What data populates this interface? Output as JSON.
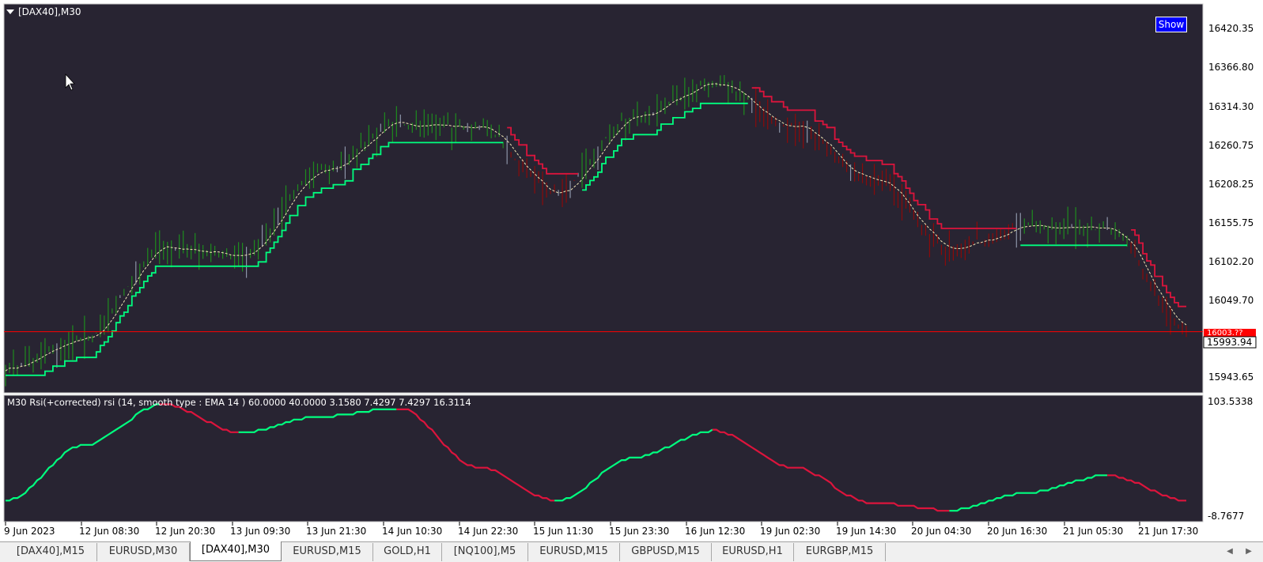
{
  "main_chart": {
    "title": "[DAX40],M30",
    "show_button": "Show",
    "current_price": "15993.94",
    "hidden_price": "16003.??",
    "price_labels": [
      "16420.35",
      "16366.80",
      "16314.30",
      "16260.75",
      "16208.25",
      "16155.75",
      "16102.20",
      "16049.70",
      "15943.65"
    ]
  },
  "indicator": {
    "title": "M30 Rsi(+corrected) rsi (14, smooth type : EMA  14 ) 60.0000 40.0000 3.1580 7.4297 7.4297 16.3114",
    "max_label": "103.5338",
    "min_label": "-8.7677"
  },
  "time_labels": [
    "9 Jun 2023",
    "12 Jun 08:30",
    "12 Jun 20:30",
    "13 Jun 09:30",
    "13 Jun 21:30",
    "14 Jun 10:30",
    "14 Jun 22:30",
    "15 Jun 11:30",
    "15 Jun 23:30",
    "16 Jun 12:30",
    "19 Jun 02:30",
    "19 Jun 14:30",
    "20 Jun 04:30",
    "20 Jun 16:30",
    "21 Jun 05:30",
    "21 Jun 17:30"
  ],
  "tabs": [
    {
      "label": "[DAX40],M15",
      "active": false
    },
    {
      "label": "EURUSD,M30",
      "active": false
    },
    {
      "label": "[DAX40],M30",
      "active": true
    },
    {
      "label": "EURUSD,M15",
      "active": false
    },
    {
      "label": "GOLD,H1",
      "active": false
    },
    {
      "label": "[NQ100],M5",
      "active": false
    },
    {
      "label": "EURUSD,M15",
      "active": false
    },
    {
      "label": "GBPUSD,M15",
      "active": false
    },
    {
      "label": "EURUSD,H1",
      "active": false
    },
    {
      "label": "EURGBP,M15",
      "active": false
    }
  ],
  "colors": {
    "background": "#282432",
    "bull": "#00ff7f",
    "bear": "#dc143c",
    "bull_bar": "#1e8c1e",
    "bear_bar": "#8b0a0a",
    "neutral_bar": "#8c94a8",
    "price_line": "#ff0000"
  },
  "chart_data": {
    "type": "line",
    "ylim": [
      15943.65,
      16420.35
    ],
    "x": [
      "9 Jun 2023",
      "12 Jun 08:30",
      "12 Jun 20:30",
      "13 Jun 09:30",
      "13 Jun 21:30",
      "14 Jun 10:30",
      "14 Jun 22:30",
      "15 Jun 11:30",
      "15 Jun 23:30",
      "16 Jun 12:30",
      "19 Jun 02:30",
      "19 Jun 14:30",
      "20 Jun 04:30",
      "20 Jun 16:30",
      "21 Jun 05:30",
      "21 Jun 17:30"
    ],
    "series": [
      {
        "values": [
          15955,
          15995,
          16120,
          16110,
          16225,
          16290,
          16285,
          16195,
          16300,
          16345,
          16285,
          16215,
          16120,
          16148,
          16145,
          16010
        ]
      }
    ],
    "rsi_ylim": [
      -8.7677,
      103.5338
    ],
    "rsi_values": [
      5.0,
      60.0,
      100.0,
      72.0,
      88.0,
      96.0,
      38.0,
      5.0,
      48.0,
      74.0,
      38.0,
      3.0,
      -4.5,
      13.0,
      30.0,
      5.0
    ]
  }
}
